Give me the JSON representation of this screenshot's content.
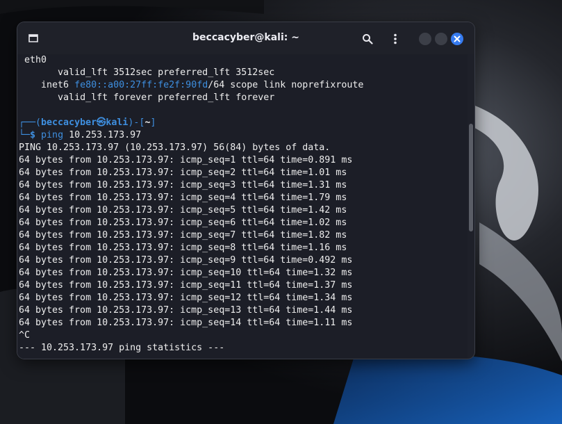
{
  "window": {
    "title": "beccacyber@kali: ~"
  },
  "terminal": {
    "iface_line": "eth0",
    "valid1": "valid_lft 3512sec preferred_lft 3512sec",
    "inet6_prefix": "inet6",
    "inet6_addr": "fe80::a00:27ff:fe2f:90fd",
    "inet6_rest": "/64 scope link noprefixroute",
    "valid2": "valid_lft forever preferred_lft forever",
    "prompt_open": "┌──(",
    "prompt_user": "beccacyber㉿kali",
    "prompt_mid": ")-[",
    "prompt_dir": "~",
    "prompt_close": "]",
    "prompt2": "└─",
    "prompt_dollar": "$",
    "command": "ping",
    "command_arg": "10.253.173.97",
    "ping_header": "PING 10.253.173.97 (10.253.173.97) 56(84) bytes of data.",
    "replies": [
      "64 bytes from 10.253.173.97: icmp_seq=1 ttl=64 time=0.891 ms",
      "64 bytes from 10.253.173.97: icmp_seq=2 ttl=64 time=1.01 ms",
      "64 bytes from 10.253.173.97: icmp_seq=3 ttl=64 time=1.31 ms",
      "64 bytes from 10.253.173.97: icmp_seq=4 ttl=64 time=1.79 ms",
      "64 bytes from 10.253.173.97: icmp_seq=5 ttl=64 time=1.42 ms",
      "64 bytes from 10.253.173.97: icmp_seq=6 ttl=64 time=1.02 ms",
      "64 bytes from 10.253.173.97: icmp_seq=7 ttl=64 time=1.82 ms",
      "64 bytes from 10.253.173.97: icmp_seq=8 ttl=64 time=1.16 ms",
      "64 bytes from 10.253.173.97: icmp_seq=9 ttl=64 time=0.492 ms",
      "64 bytes from 10.253.173.97: icmp_seq=10 ttl=64 time=1.32 ms",
      "64 bytes from 10.253.173.97: icmp_seq=11 ttl=64 time=1.37 ms",
      "64 bytes from 10.253.173.97: icmp_seq=12 ttl=64 time=1.34 ms",
      "64 bytes from 10.253.173.97: icmp_seq=13 ttl=64 time=1.44 ms",
      "64 bytes from 10.253.173.97: icmp_seq=14 ttl=64 time=1.11 ms"
    ],
    "interrupt": "^C",
    "stats_header": "--- 10.253.173.97 ping statistics ---"
  },
  "colors": {
    "accent": "#367bf0",
    "prompt": "#3e8fe0",
    "background": "#1c1e27"
  },
  "icons": {
    "new_tab": "new-tab-icon",
    "search": "search-icon",
    "menu": "kebab-menu-icon",
    "close": "close-icon"
  }
}
